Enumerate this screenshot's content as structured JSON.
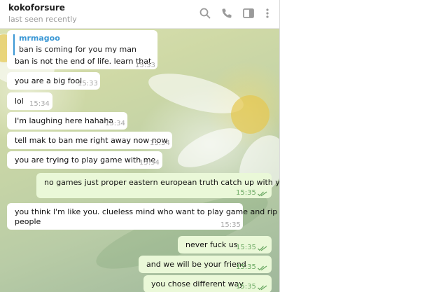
{
  "header": {
    "name": "kokoforsure",
    "status": "last seen recently",
    "icons": [
      "search-icon",
      "phone-icon",
      "sidebar-icon",
      "more-icon"
    ]
  },
  "messages": [
    {
      "dir": "in",
      "reply_to": {
        "name": "mrmagoo",
        "text": "ban is coming for you my man"
      },
      "text": "ban is not the end of life. learn that",
      "time": "15:33"
    },
    {
      "dir": "in",
      "text": "you are a big fool",
      "time": "15:33"
    },
    {
      "dir": "in",
      "text": "lol",
      "time": "15:34"
    },
    {
      "dir": "in",
      "text": "I'm laughing here hahaha",
      "time": "15:34"
    },
    {
      "dir": "in",
      "text": "tell mak to ban me right away now now",
      "time": "15:34"
    },
    {
      "dir": "in",
      "text": "you are trying to play game with me",
      "time": "15:34"
    },
    {
      "dir": "out",
      "text": "no games just proper eastern european truth catch up with you",
      "time": "15:35",
      "read": true
    },
    {
      "dir": "in",
      "text_lines": [
        "you think I'm like you. clueless mind who want to play game and rip",
        "people"
      ],
      "time": "15:35"
    },
    {
      "dir": "out",
      "text": "never fuck us",
      "time": "15:35",
      "read": true
    },
    {
      "dir": "out",
      "text": "and we will be your friend",
      "time": "15:35",
      "read": true
    },
    {
      "dir": "out",
      "text": "you chose different way",
      "time": "15:35",
      "read": true
    }
  ],
  "colors": {
    "incoming": "#ffffff",
    "outgoing": "#eaf8d8",
    "accent": "#3a97d4",
    "read_check": "#6ca964"
  }
}
